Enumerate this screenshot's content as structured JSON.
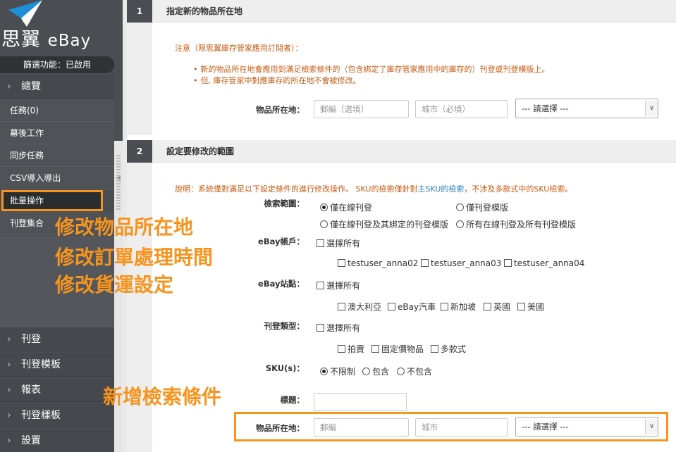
{
  "brand": {
    "name_cn": "思翼",
    "name_en": "eBay",
    "logo_icon": "paper-plane-icon"
  },
  "sidebar": {
    "filter_status": "篩選功能：已啟用",
    "overview": "總覽",
    "sub_items": [
      {
        "label": "任務(0)"
      },
      {
        "label": "幕後工作"
      },
      {
        "label": "同步任務"
      },
      {
        "label": "CSV導入導出"
      },
      {
        "label": "批量操作",
        "active": true
      },
      {
        "label": "刊登集合"
      }
    ],
    "sections": [
      {
        "label": "刊登"
      },
      {
        "label": "刊登模板"
      },
      {
        "label": "報表"
      },
      {
        "label": "刊登樣板"
      },
      {
        "label": "設置"
      }
    ]
  },
  "section1": {
    "num": "1",
    "title": "指定新的物品所在地",
    "note_title": "注意（限思翼庫存管家應用訂閱者）：",
    "notes": [
      "新的物品所在地會應用到滿足檢索條件的（包含綁定了庫存管家應用中的庫存的）刊登或刊登模版上。",
      "但, 庫存管家中對應庫存的所在地不會被修改。"
    ],
    "location_label": "物品所在地：",
    "postcode_placeholder": "郵編（選填）",
    "city_placeholder": "城市（必填）",
    "country_select": "--- 請選擇 ---"
  },
  "section2": {
    "num": "2",
    "title": "設定要修改的範圍",
    "note_prefix": "說明：系統僅對滿足以下設定條件的進行修改操作。 SKU的檢索僅針對",
    "note_link": "主SKU的檢索",
    "note_suffix": "，不涉及多款式中的SKU檢索。",
    "scope_label": "檢索範圍：",
    "scope_options": [
      "僅在線刊登",
      "僅刊登模版",
      "僅在線刊登及其綁定的刊登模版",
      "所有在線刊登及所有刊登模版"
    ],
    "account_label": "eBay帳戶：",
    "select_all": "選擇所有",
    "accounts": [
      "testuser_anna02",
      "testuser_anna03",
      "testuser_anna04"
    ],
    "site_label": "eBay站點：",
    "sites": [
      "澳大利亞",
      "eBay汽車",
      "新加坡",
      "英國",
      "美國"
    ],
    "type_label": "刊登類型：",
    "types": [
      "拍賣",
      "固定價物品",
      "多款式"
    ],
    "sku_label": "SKU(s)：",
    "sku_options": [
      "不限制",
      "包含",
      "不包含"
    ],
    "title_label": "標題：",
    "location_label": "物品所在地：",
    "postcode_placeholder": "郵編",
    "city_placeholder": "城市",
    "country_select": "--- 請選擇 ---"
  },
  "annotations": {
    "lines": [
      "修改物品所在地",
      "修改訂單處理時間",
      "修改貨運設定"
    ],
    "new_filter": "新增檢索條件",
    "accent_color": "#f7941d"
  }
}
